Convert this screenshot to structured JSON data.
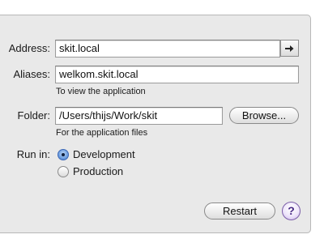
{
  "form": {
    "address": {
      "label": "Address:",
      "value": "skit.local"
    },
    "aliases": {
      "label": "Aliases:",
      "value": "welkom.skit.local",
      "hint": "To view the application"
    },
    "folder": {
      "label": "Folder:",
      "value": "/Users/thijs/Work/skit",
      "hint": "For the application files",
      "browse_label": "Browse..."
    },
    "run_in": {
      "label": "Run in:",
      "options": [
        {
          "label": "Development",
          "selected": true
        },
        {
          "label": "Production",
          "selected": false
        }
      ]
    }
  },
  "footer": {
    "restart_label": "Restart",
    "help_label": "?"
  },
  "icons": {
    "go": "arrow-right-icon",
    "help": "question-mark-icon"
  },
  "colors": {
    "panel": "#e9e9e9",
    "help_accent": "#7b5ea8",
    "radio_selected": "#3e72c4"
  }
}
